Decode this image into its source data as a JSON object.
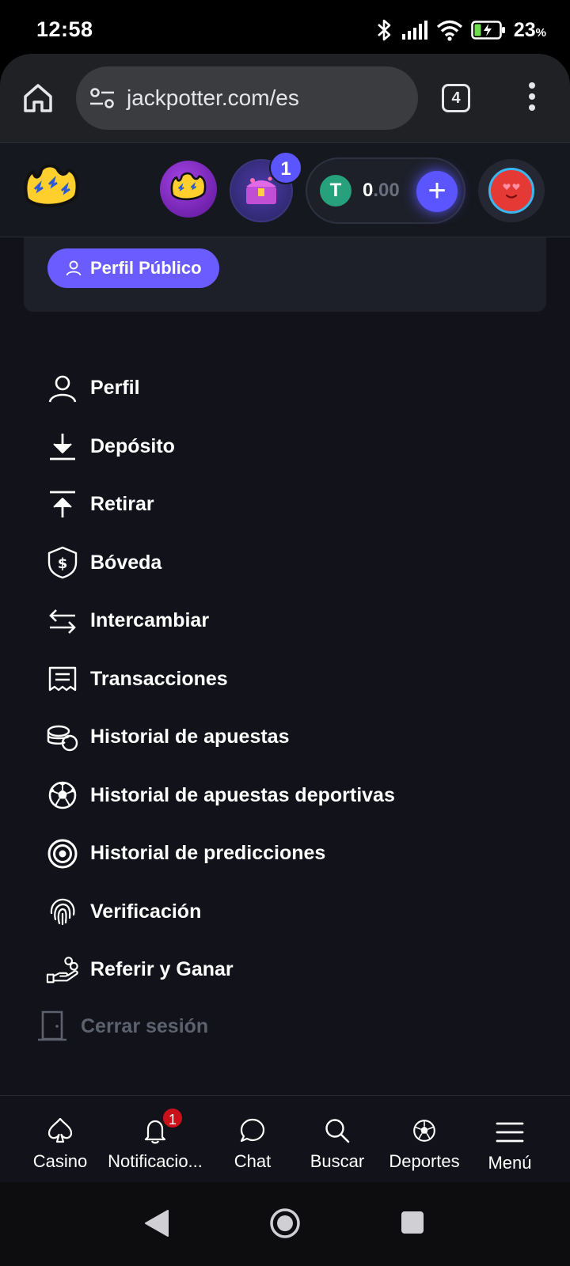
{
  "status_bar": {
    "time": "12:58",
    "battery_percent": "23",
    "battery_unit": "%",
    "icons": [
      "bluetooth-icon",
      "signal-icon",
      "wifi-icon",
      "battery-charging-icon"
    ]
  },
  "browser": {
    "url": "jackpotter.com/es",
    "tab_count": "4",
    "icons": [
      "home-icon",
      "site-settings-icon",
      "tabs-icon",
      "more-vert-icon"
    ]
  },
  "header": {
    "chest_badge_count": "1",
    "balance_integer": "0",
    "balance_fraction": ".00",
    "currency_icon_glyph": "T",
    "deposit_glyph": "+",
    "brand_color": "#5b55ff",
    "currency_color": "#26a17b"
  },
  "profile_card": {
    "public_profile_label": "Perfil Público"
  },
  "menu": {
    "items": [
      {
        "label": "Perfil",
        "icon": "user-icon"
      },
      {
        "label": "Depósito",
        "icon": "download-icon"
      },
      {
        "label": "Retirar",
        "icon": "upload-icon"
      },
      {
        "label": "Bóveda",
        "icon": "vault-shield-icon"
      },
      {
        "label": "Intercambiar",
        "icon": "swap-arrows-icon"
      },
      {
        "label": "Transacciones",
        "icon": "receipt-icon"
      },
      {
        "label": "Historial de apuestas",
        "icon": "coins-stack-icon"
      },
      {
        "label": "Historial de apuestas deportivas",
        "icon": "soccer-ball-icon"
      },
      {
        "label": "Historial de predicciones",
        "icon": "target-icon"
      },
      {
        "label": "Verificación",
        "icon": "fingerprint-icon"
      },
      {
        "label": "Referir y Ganar",
        "icon": "hand-coins-icon"
      }
    ],
    "logout_label": "Cerrar sesión"
  },
  "bottom_nav": {
    "items": [
      {
        "label": "Casino",
        "icon": "spade-icon"
      },
      {
        "label": "Notificacio...",
        "icon": "bell-icon"
      },
      {
        "label": "Chat",
        "icon": "chat-bubble-icon"
      },
      {
        "label": "Buscar",
        "icon": "search-icon"
      },
      {
        "label": "Deportes",
        "icon": "soccer-ball-icon"
      },
      {
        "label": "Menú",
        "icon": "hamburger-menu-icon"
      }
    ],
    "notification_badge": "1",
    "badge_color": "#c9111b"
  },
  "android_nav": {
    "icons": [
      "back-triangle-icon",
      "home-circle-icon",
      "recents-square-icon"
    ]
  }
}
